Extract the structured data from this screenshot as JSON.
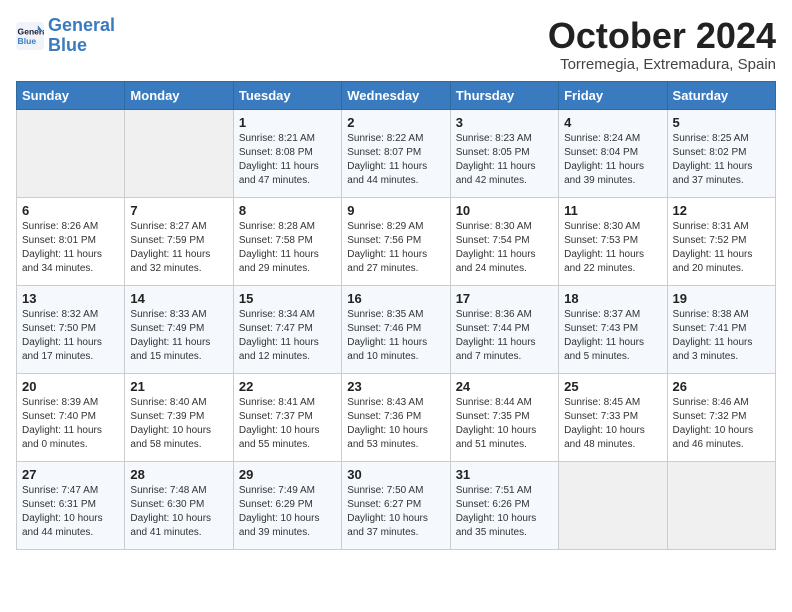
{
  "header": {
    "logo_line1": "General",
    "logo_line2": "Blue",
    "month_title": "October 2024",
    "subtitle": "Torremegia, Extremadura, Spain"
  },
  "weekdays": [
    "Sunday",
    "Monday",
    "Tuesday",
    "Wednesday",
    "Thursday",
    "Friday",
    "Saturday"
  ],
  "weeks": [
    [
      {
        "day": "",
        "sunrise": "",
        "sunset": "",
        "daylight": ""
      },
      {
        "day": "",
        "sunrise": "",
        "sunset": "",
        "daylight": ""
      },
      {
        "day": "1",
        "sunrise": "Sunrise: 8:21 AM",
        "sunset": "Sunset: 8:08 PM",
        "daylight": "Daylight: 11 hours and 47 minutes."
      },
      {
        "day": "2",
        "sunrise": "Sunrise: 8:22 AM",
        "sunset": "Sunset: 8:07 PM",
        "daylight": "Daylight: 11 hours and 44 minutes."
      },
      {
        "day": "3",
        "sunrise": "Sunrise: 8:23 AM",
        "sunset": "Sunset: 8:05 PM",
        "daylight": "Daylight: 11 hours and 42 minutes."
      },
      {
        "day": "4",
        "sunrise": "Sunrise: 8:24 AM",
        "sunset": "Sunset: 8:04 PM",
        "daylight": "Daylight: 11 hours and 39 minutes."
      },
      {
        "day": "5",
        "sunrise": "Sunrise: 8:25 AM",
        "sunset": "Sunset: 8:02 PM",
        "daylight": "Daylight: 11 hours and 37 minutes."
      }
    ],
    [
      {
        "day": "6",
        "sunrise": "Sunrise: 8:26 AM",
        "sunset": "Sunset: 8:01 PM",
        "daylight": "Daylight: 11 hours and 34 minutes."
      },
      {
        "day": "7",
        "sunrise": "Sunrise: 8:27 AM",
        "sunset": "Sunset: 7:59 PM",
        "daylight": "Daylight: 11 hours and 32 minutes."
      },
      {
        "day": "8",
        "sunrise": "Sunrise: 8:28 AM",
        "sunset": "Sunset: 7:58 PM",
        "daylight": "Daylight: 11 hours and 29 minutes."
      },
      {
        "day": "9",
        "sunrise": "Sunrise: 8:29 AM",
        "sunset": "Sunset: 7:56 PM",
        "daylight": "Daylight: 11 hours and 27 minutes."
      },
      {
        "day": "10",
        "sunrise": "Sunrise: 8:30 AM",
        "sunset": "Sunset: 7:54 PM",
        "daylight": "Daylight: 11 hours and 24 minutes."
      },
      {
        "day": "11",
        "sunrise": "Sunrise: 8:30 AM",
        "sunset": "Sunset: 7:53 PM",
        "daylight": "Daylight: 11 hours and 22 minutes."
      },
      {
        "day": "12",
        "sunrise": "Sunrise: 8:31 AM",
        "sunset": "Sunset: 7:52 PM",
        "daylight": "Daylight: 11 hours and 20 minutes."
      }
    ],
    [
      {
        "day": "13",
        "sunrise": "Sunrise: 8:32 AM",
        "sunset": "Sunset: 7:50 PM",
        "daylight": "Daylight: 11 hours and 17 minutes."
      },
      {
        "day": "14",
        "sunrise": "Sunrise: 8:33 AM",
        "sunset": "Sunset: 7:49 PM",
        "daylight": "Daylight: 11 hours and 15 minutes."
      },
      {
        "day": "15",
        "sunrise": "Sunrise: 8:34 AM",
        "sunset": "Sunset: 7:47 PM",
        "daylight": "Daylight: 11 hours and 12 minutes."
      },
      {
        "day": "16",
        "sunrise": "Sunrise: 8:35 AM",
        "sunset": "Sunset: 7:46 PM",
        "daylight": "Daylight: 11 hours and 10 minutes."
      },
      {
        "day": "17",
        "sunrise": "Sunrise: 8:36 AM",
        "sunset": "Sunset: 7:44 PM",
        "daylight": "Daylight: 11 hours and 7 minutes."
      },
      {
        "day": "18",
        "sunrise": "Sunrise: 8:37 AM",
        "sunset": "Sunset: 7:43 PM",
        "daylight": "Daylight: 11 hours and 5 minutes."
      },
      {
        "day": "19",
        "sunrise": "Sunrise: 8:38 AM",
        "sunset": "Sunset: 7:41 PM",
        "daylight": "Daylight: 11 hours and 3 minutes."
      }
    ],
    [
      {
        "day": "20",
        "sunrise": "Sunrise: 8:39 AM",
        "sunset": "Sunset: 7:40 PM",
        "daylight": "Daylight: 11 hours and 0 minutes."
      },
      {
        "day": "21",
        "sunrise": "Sunrise: 8:40 AM",
        "sunset": "Sunset: 7:39 PM",
        "daylight": "Daylight: 10 hours and 58 minutes."
      },
      {
        "day": "22",
        "sunrise": "Sunrise: 8:41 AM",
        "sunset": "Sunset: 7:37 PM",
        "daylight": "Daylight: 10 hours and 55 minutes."
      },
      {
        "day": "23",
        "sunrise": "Sunrise: 8:43 AM",
        "sunset": "Sunset: 7:36 PM",
        "daylight": "Daylight: 10 hours and 53 minutes."
      },
      {
        "day": "24",
        "sunrise": "Sunrise: 8:44 AM",
        "sunset": "Sunset: 7:35 PM",
        "daylight": "Daylight: 10 hours and 51 minutes."
      },
      {
        "day": "25",
        "sunrise": "Sunrise: 8:45 AM",
        "sunset": "Sunset: 7:33 PM",
        "daylight": "Daylight: 10 hours and 48 minutes."
      },
      {
        "day": "26",
        "sunrise": "Sunrise: 8:46 AM",
        "sunset": "Sunset: 7:32 PM",
        "daylight": "Daylight: 10 hours and 46 minutes."
      }
    ],
    [
      {
        "day": "27",
        "sunrise": "Sunrise: 7:47 AM",
        "sunset": "Sunset: 6:31 PM",
        "daylight": "Daylight: 10 hours and 44 minutes."
      },
      {
        "day": "28",
        "sunrise": "Sunrise: 7:48 AM",
        "sunset": "Sunset: 6:30 PM",
        "daylight": "Daylight: 10 hours and 41 minutes."
      },
      {
        "day": "29",
        "sunrise": "Sunrise: 7:49 AM",
        "sunset": "Sunset: 6:29 PM",
        "daylight": "Daylight: 10 hours and 39 minutes."
      },
      {
        "day": "30",
        "sunrise": "Sunrise: 7:50 AM",
        "sunset": "Sunset: 6:27 PM",
        "daylight": "Daylight: 10 hours and 37 minutes."
      },
      {
        "day": "31",
        "sunrise": "Sunrise: 7:51 AM",
        "sunset": "Sunset: 6:26 PM",
        "daylight": "Daylight: 10 hours and 35 minutes."
      },
      {
        "day": "",
        "sunrise": "",
        "sunset": "",
        "daylight": ""
      },
      {
        "day": "",
        "sunrise": "",
        "sunset": "",
        "daylight": ""
      }
    ]
  ]
}
